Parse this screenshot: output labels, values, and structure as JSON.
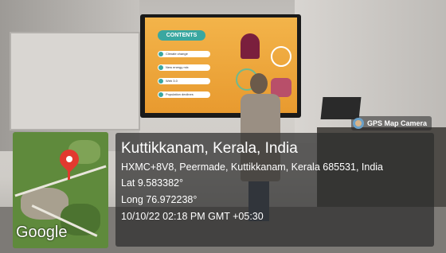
{
  "slide": {
    "heading": "CONTENTS",
    "items": [
      {
        "number": "1",
        "label": "Climate change"
      },
      {
        "number": "2",
        "label": "New energy mix"
      },
      {
        "number": "3",
        "label": "Web 3.0"
      },
      {
        "number": "4",
        "label": "Population declines"
      }
    ]
  },
  "badge": {
    "label": "GPS Map Camera",
    "icon": "gps-map-camera-icon"
  },
  "map": {
    "logo": "Google",
    "pin_icon": "location-pin-icon"
  },
  "location": {
    "title": "Kuttikkanam, Kerala, India",
    "address": "HXMC+8V8, Peermade, Kuttikkanam, Kerala 685531, India",
    "latitude": "Lat 9.583382°",
    "longitude": "Long 76.972238°",
    "timestamp": "10/10/22 02:18 PM GMT +05:30"
  }
}
